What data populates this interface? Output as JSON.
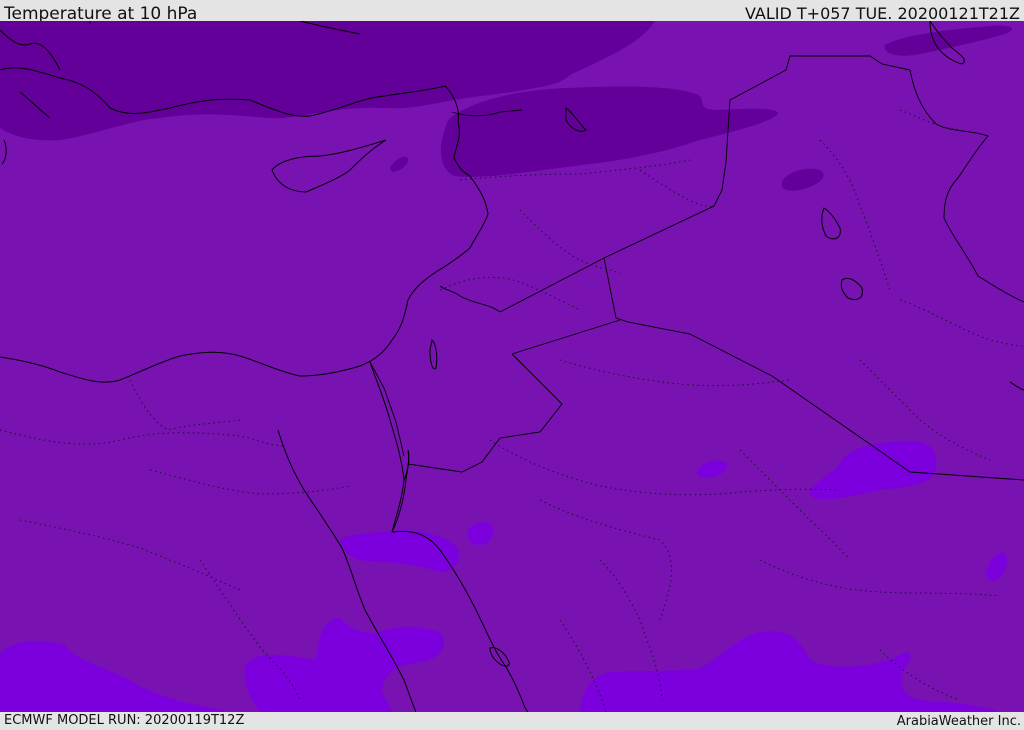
{
  "header": {
    "title": "Temperature at 10 hPa",
    "valid": "VALID T+057 TUE. 20200121T21Z"
  },
  "footer": {
    "model_run": "ECMWF MODEL RUN: 20200119T12Z",
    "credit": "ArabiaWeather Inc."
  },
  "map": {
    "field": "Temperature",
    "level": "10 hPa",
    "colors": {
      "base": "#7813b1",
      "cold": "#630099",
      "warm": "#7b00dd",
      "coast": "#000000"
    }
  }
}
